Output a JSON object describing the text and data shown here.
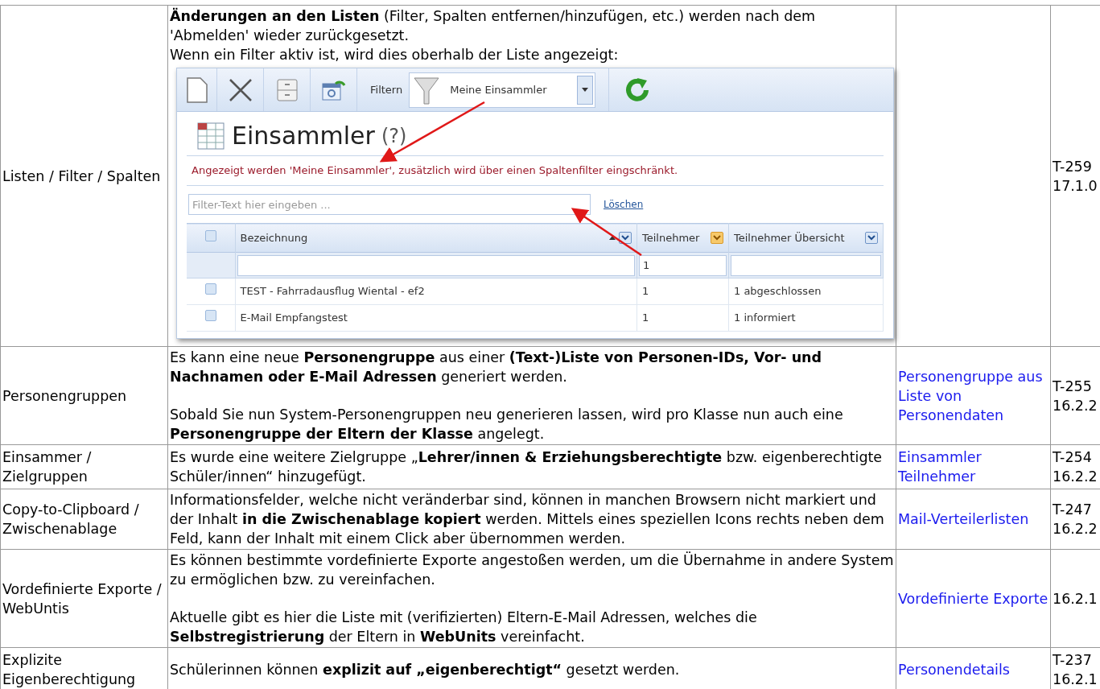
{
  "rows": [
    {
      "topic": "Listen / Filter / Spalten",
      "paragraphs": [
        [
          "**Änderungen an den Listen** (Filter, Spalten entfernen/hinzufügen, etc.) werden nach dem 'Abmelden' wieder zurückgesetzt.",
          "Wenn ein Filter aktiv ist, wird dies oberhalb der Liste angezeigt:"
        ]
      ],
      "screenshot": {
        "filter_label": "Filtern",
        "filter_value": "Meine Einsammler",
        "title": "Einsammler",
        "help": "(?)",
        "notice": "Angezeigt werden 'Meine Einsammler', zusätzlich wird über einen Spaltenfilter eingschränkt.",
        "search_placeholder": "Filter-Text hier eingeben ...",
        "clear_link": "Löschen",
        "header_checked": false,
        "columns": [
          {
            "label": "Bezeichnung",
            "sorted": true,
            "filtered": false
          },
          {
            "label": "Teilnehmer",
            "sorted": false,
            "filtered": true,
            "filter_value": "1"
          },
          {
            "label": "Teilnehmer Übersicht",
            "sorted": false,
            "filtered": false
          }
        ],
        "rows": [
          {
            "checked": false,
            "cells": [
              "TEST - Fahrradausflug Wiental - ef2",
              "1",
              "1 abgeschlossen"
            ]
          },
          {
            "checked": false,
            "cells": [
              "E-Mail Empfangstest",
              "1",
              "1 informiert"
            ]
          }
        ]
      },
      "links": [],
      "ticket": "T-259",
      "version": "17.1.0"
    },
    {
      "topic": "Personengruppen",
      "paragraphs": [
        [
          "Es kann eine neue **Personengruppe** aus einer **(Text-)Liste von Personen-IDs, Vor- und Nachnamen oder E-Mail Adressen** generiert werden."
        ],
        [
          "Sobald Sie nun System-Personengruppen neu generieren lassen, wird pro Klasse nun auch eine **Personengruppe der Eltern der Klasse** angelegt."
        ]
      ],
      "links": [
        "Personengruppe aus Liste von Personendaten"
      ],
      "ticket": "T-255",
      "version": "16.2.2"
    },
    {
      "topic": "Einsammer / Zielgruppen",
      "paragraphs": [
        [
          "Es wurde eine weitere Zielgruppe „**Lehrer/innen & Erziehungsberechtigte** bzw. eigenberechtigte Schüler/innen“ hinzugefügt."
        ]
      ],
      "links": [
        "Einsammler Teilnehmer"
      ],
      "ticket": "T-254",
      "version": "16.2.2"
    },
    {
      "topic": "Copy-to-Clipboard / Zwischenablage",
      "paragraphs": [
        [
          "Informationsfelder, welche nicht veränderbar sind, können in manchen Browsern nicht markiert und der Inhalt **in die Zwischenablage kopiert** werden. Mittels eines speziellen Icons rechts neben dem Feld, kann der Inhalt mit einem Click aber übernommen werden."
        ]
      ],
      "links": [
        "Mail-Verteilerlisten"
      ],
      "ticket": "T-247",
      "version": "16.2.2"
    },
    {
      "topic": "Vordefinierte Exporte / WebUntis",
      "paragraphs": [
        [
          "Es können bestimmte vordefinierte Exporte angestoßen werden, um die Übernahme in andere System zu ermöglichen bzw. zu vereinfachen."
        ],
        [
          "Aktuelle gibt es hier die Liste mit (verifizierten) Eltern-E-Mail Adressen, welches die **Selbstregistrierung** der Eltern in **WebUnits** vereinfacht."
        ]
      ],
      "links": [
        "Vordefinierte Exporte"
      ],
      "version": "16.2.1"
    },
    {
      "topic": "Explizite Eigenberechtigung",
      "paragraphs": [
        [
          "Schülerinnen können **explizit auf „eigenberechtigt“** gesetzt werden."
        ]
      ],
      "links": [
        "Personendetails"
      ],
      "ticket": "T-237",
      "version": "16.2.1"
    }
  ]
}
